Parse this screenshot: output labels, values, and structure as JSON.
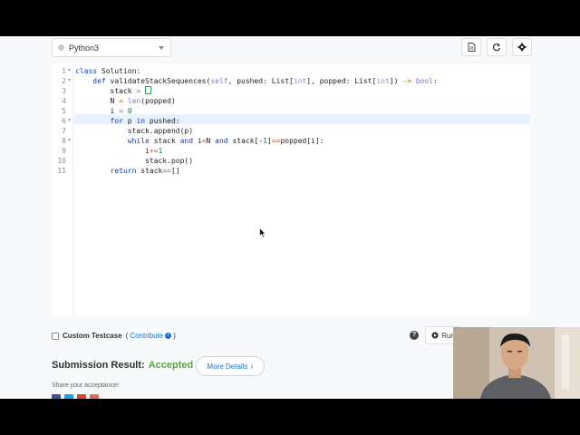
{
  "toolbar": {
    "language": "Python3",
    "icons": [
      "file-icon",
      "refresh-icon",
      "settings-icon"
    ]
  },
  "editor": {
    "line_numbers": [
      "1",
      "2",
      "3",
      "4",
      "5",
      "6",
      "7",
      "8",
      "9",
      "10",
      "11"
    ],
    "lines": [
      "class Solution:",
      "    def validateStackSequences(self, pushed: List[int], popped: List[int]) -> bool:",
      "        stack = []",
      "        N = len(popped)",
      "        i = 0",
      "        for p in pushed:",
      "            stack.append(p)",
      "            while stack and i<N and stack[-1]==popped[i]:",
      "                i+=1",
      "                stack.pop()",
      "        return stack==[]"
    ]
  },
  "custom_testcase": {
    "label": "Custom Testcase",
    "open_paren": "(",
    "contribute": "Contribute",
    "close_paren": ")"
  },
  "actions": {
    "help": "?",
    "run_label": "Run"
  },
  "result": {
    "label": "Submission Result:",
    "status": "Accepted",
    "more_details": "More Details"
  },
  "share": {
    "text": "Share your acceptance!"
  },
  "colors": {
    "accepted": "#5aa641",
    "link": "#1a73c9",
    "submit": "#2e7de0"
  }
}
